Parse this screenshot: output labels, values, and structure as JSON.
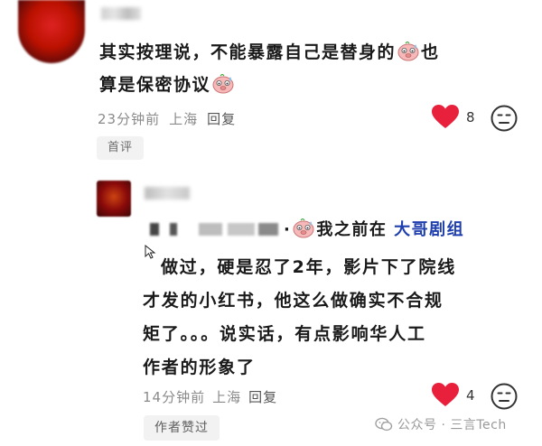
{
  "comment1": {
    "text_part1": "其实按理说，不能暴露自己是替身的",
    "text_part2": "也",
    "text_part3": "算是保密协议",
    "time": "23分钟前",
    "location": "上海",
    "reply_label": "回复",
    "likes": "8",
    "tag": "首评",
    "emoji": "sweat-pig-emoji"
  },
  "comment2": {
    "quote_tail": "·",
    "line1_text": "我之前在",
    "line1_link": "大哥剧组",
    "body_lines": [
      "做过，硬是忍了2年，影片下了院线",
      "才发的小红书，他这么做确实不合规",
      "矩了。。。说实话，有点影响华人工",
      "作者的形象了"
    ],
    "time": "14分钟前",
    "location": "上海",
    "reply_label": "回复",
    "likes": "4",
    "tag": "作者赞过"
  },
  "watermark": {
    "text": "公众号 · 三言Tech"
  },
  "colors": {
    "like_red": "#e8203c",
    "link_blue": "#1f3fae",
    "meta_gray": "#8a8a8a"
  }
}
